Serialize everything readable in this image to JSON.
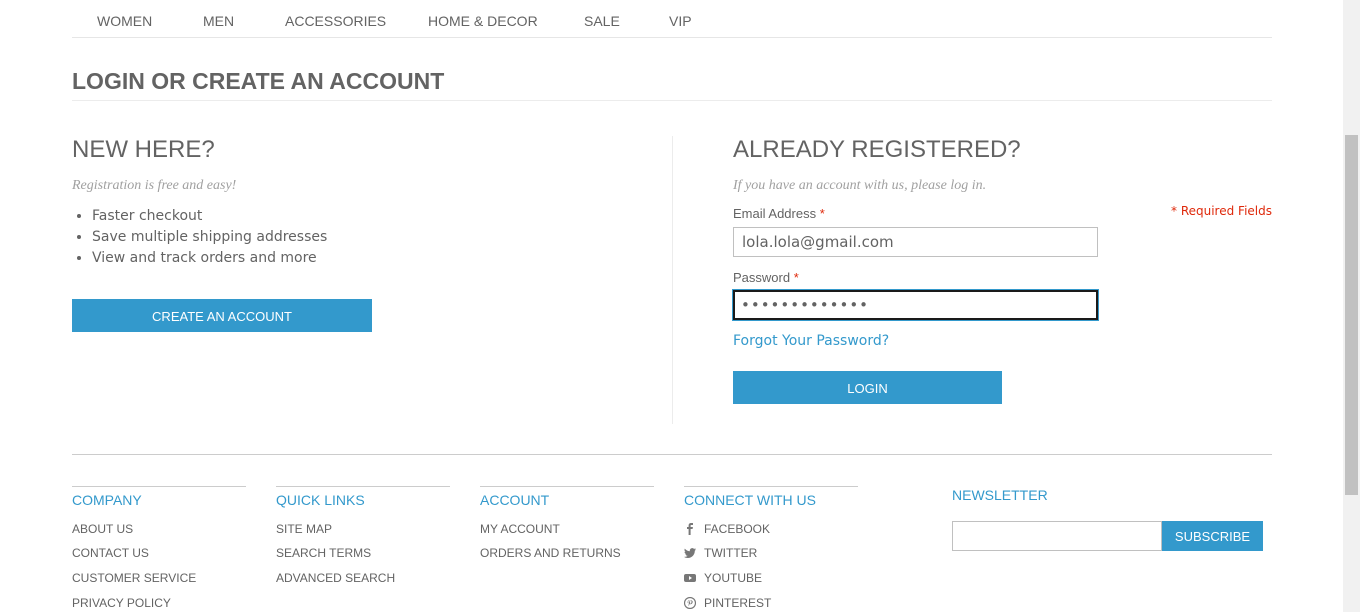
{
  "nav": {
    "items": [
      "WOMEN",
      "MEN",
      "ACCESSORIES",
      "HOME & DECOR",
      "SALE",
      "VIP"
    ]
  },
  "page_title": "LOGIN OR CREATE AN ACCOUNT",
  "new_customer": {
    "heading": "NEW HERE?",
    "intro": "Registration is free and easy!",
    "benefits": [
      "Faster checkout",
      "Save multiple shipping addresses",
      "View and track orders and more"
    ],
    "create_button": "CREATE AN ACCOUNT"
  },
  "login": {
    "heading": "ALREADY REGISTERED?",
    "intro": "If you have an account with us, please log in.",
    "required_note": "* Required Fields",
    "email_label": "Email Address",
    "email_value": "lola.lola@gmail.com",
    "password_label": "Password",
    "password_value": "•••••••••••••",
    "required_star": "*",
    "forgot_link": "Forgot Your Password?",
    "login_button": "LOGIN"
  },
  "footer": {
    "columns": [
      {
        "title": "COMPANY",
        "links": [
          "ABOUT US",
          "CONTACT US",
          "CUSTOMER SERVICE",
          "PRIVACY POLICY"
        ]
      },
      {
        "title": "QUICK LINKS",
        "links": [
          "SITE MAP",
          "SEARCH TERMS",
          "ADVANCED SEARCH"
        ]
      },
      {
        "title": "ACCOUNT",
        "links": [
          "MY ACCOUNT",
          "ORDERS AND RETURNS"
        ]
      },
      {
        "title": "CONNECT WITH US",
        "links": [
          "FACEBOOK",
          "TWITTER",
          "YOUTUBE",
          "PINTEREST"
        ],
        "icons": [
          "facebook-icon",
          "twitter-icon",
          "youtube-icon",
          "pinterest-icon"
        ]
      }
    ],
    "newsletter": {
      "title": "NEWSLETTER",
      "subscribe_button": "SUBSCRIBE"
    }
  },
  "colors": {
    "accent": "#3399cc",
    "required": "#df280a",
    "text": "#636363"
  }
}
